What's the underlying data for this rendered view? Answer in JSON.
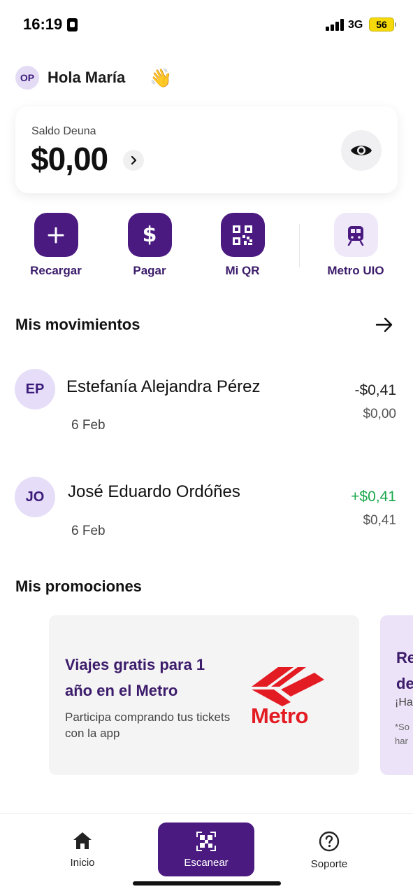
{
  "status_bar": {
    "time": "16:19",
    "network": "3G",
    "battery": "56"
  },
  "header": {
    "avatar_initials": "OP",
    "greeting": "Hola María",
    "wave_emoji": "👋"
  },
  "balance": {
    "label": "Saldo Deuna",
    "amount": "$0,00"
  },
  "actions": [
    {
      "label": "Recargar",
      "icon": "plus-icon"
    },
    {
      "label": "Pagar",
      "icon": "dollar-icon"
    },
    {
      "label": "Mi QR",
      "icon": "qr-icon"
    },
    {
      "label": "Metro UIO",
      "icon": "metro-train-icon"
    }
  ],
  "movements": {
    "title": "Mis movimientos",
    "items": [
      {
        "initials": "EP",
        "name": "Estefanía Alejandra Pérez",
        "date": "6 Feb",
        "amount": "-$0,41",
        "balance": "$0,00",
        "positive": false
      },
      {
        "initials": "JO",
        "name": "José Eduardo Ordóñes",
        "date": "6 Feb",
        "amount": "+$0,41",
        "balance": "$0,41",
        "positive": true
      }
    ]
  },
  "promotions": {
    "title": "Mis promociones",
    "cards": [
      {
        "title": "Viajes gratis para 1 año en el Metro",
        "description": "Participa comprando tus tickets con la app",
        "brand_text": "Metro"
      },
      {
        "title_line1": "Re",
        "title_line2": "de",
        "description": "¡Ha",
        "note_line1": "*So",
        "note_line2": "har"
      }
    ]
  },
  "bottom_nav": {
    "home": "Inicio",
    "scan": "Escanear",
    "support": "Soporte"
  },
  "colors": {
    "brand_purple": "#4a1a80",
    "positive_green": "#1aa84b",
    "metro_red": "#e31b23"
  }
}
